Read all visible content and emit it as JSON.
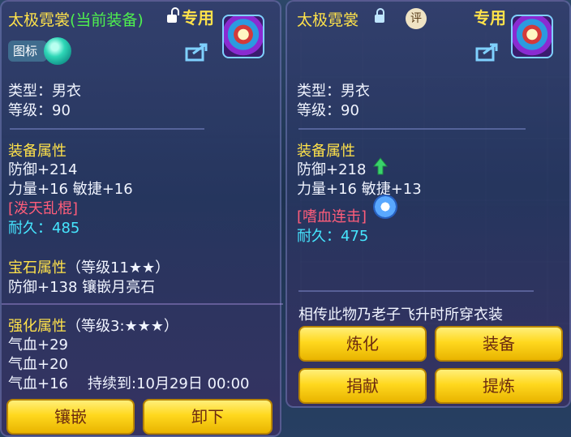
{
  "left": {
    "title": "太极霓裳",
    "status": "(当前装备)",
    "tag": "专用",
    "icon_label": "图标",
    "type_line": "类型：男衣",
    "level_line": "等级：90",
    "equip_attr_header": "装备属性",
    "defense": "防御+214",
    "attrs": "力量+16 敏捷+16",
    "skill": "[泼天乱棍]",
    "durability": "耐久：485",
    "gem_header": "宝石属性",
    "gem_level": "（等级11★★）",
    "gem_effect": "防御+138 镶嵌月亮石",
    "enhance_header": "强化属性",
    "enhance_level": "（等级3:★★★）",
    "enhance_1": "气血+29",
    "enhance_2": "气血+20",
    "enhance_3": "气血+16",
    "duration": "持续到:10月29日 00:00",
    "btn_inlay": "镶嵌",
    "btn_unequip": "卸下"
  },
  "right": {
    "title": "太极霓裳",
    "review_badge": "评",
    "tag": "专用",
    "type_line": "类型：男衣",
    "level_line": "等级：90",
    "equip_attr_header": "装备属性",
    "defense": "防御+218",
    "attrs": "力量+16 敏捷+13",
    "skill": "[嗜血连击]",
    "durability": "耐久：475",
    "description": "相传此物乃老子飞升时所穿衣装",
    "btn_refine": "炼化",
    "btn_equip": "装备",
    "btn_donate": "捐献",
    "btn_extract": "提炼"
  },
  "colors": {
    "title": "#ffe24a",
    "equipped": "#4ef04e",
    "header": "#ffe24a",
    "skill": "#ff5d7a",
    "durability": "#46e6ff",
    "upgrade_arrow": "#39d36b"
  },
  "icons": {
    "lock_open": "unlock-icon",
    "lock_closed": "lock-icon",
    "share": "share-icon",
    "orb": "gem-orb-icon",
    "up_arrow": "arrow-up-icon",
    "refresh": "refresh-icon"
  }
}
